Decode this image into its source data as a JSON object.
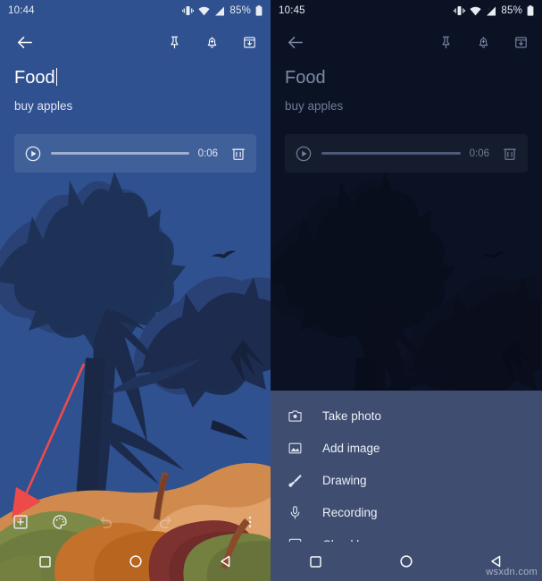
{
  "left": {
    "statusbar": {
      "clock": "10:44",
      "battery_percent": "85%",
      "icons": [
        "vibrate-icon",
        "wifi-icon",
        "signal-icon",
        "battery-icon"
      ]
    },
    "appbar": {
      "back": "back-arrow-icon",
      "actions": [
        "pin-icon",
        "reminder-bell-icon",
        "archive-icon"
      ]
    },
    "note": {
      "title": "Food",
      "body": "buy apples"
    },
    "audio": {
      "play_label": "play-icon",
      "duration": "0:06",
      "delete_label": "delete-icon"
    },
    "toolbar": {
      "add_label": "add-box-icon",
      "palette_label": "palette-icon",
      "undo_label": "undo-icon",
      "redo_label": "redo-icon",
      "overflow_label": "more-vert-icon"
    },
    "navbar": [
      "recents-square-icon",
      "home-circle-icon",
      "back-triangle-icon"
    ]
  },
  "right": {
    "statusbar": {
      "clock": "10:45",
      "battery_percent": "85%"
    },
    "note": {
      "title": "Food",
      "body": "buy apples"
    },
    "audio": {
      "duration": "0:06"
    },
    "menu": {
      "items": [
        {
          "icon": "camera-icon",
          "label": "Take photo"
        },
        {
          "icon": "image-icon",
          "label": "Add image"
        },
        {
          "icon": "brush-icon",
          "label": "Drawing"
        },
        {
          "icon": "microphone-icon",
          "label": "Recording"
        },
        {
          "icon": "checkbox-icon",
          "label": "Checkboxes"
        }
      ]
    },
    "navbar": [
      "recents-square-icon",
      "home-circle-icon",
      "back-triangle-icon"
    ]
  },
  "annotation": {
    "arrow_color": "#ef4a4a",
    "points_to": "add-box-icon"
  },
  "watermark": "wsxdn.com",
  "colors": {
    "sky": "#2f5190",
    "tree_dark": "#1c2b4c",
    "tree_mid": "#2a4176",
    "menu_bg": "#3e4d70",
    "dim_bg": "#16203a",
    "accent_red": "#ef4a4a"
  }
}
